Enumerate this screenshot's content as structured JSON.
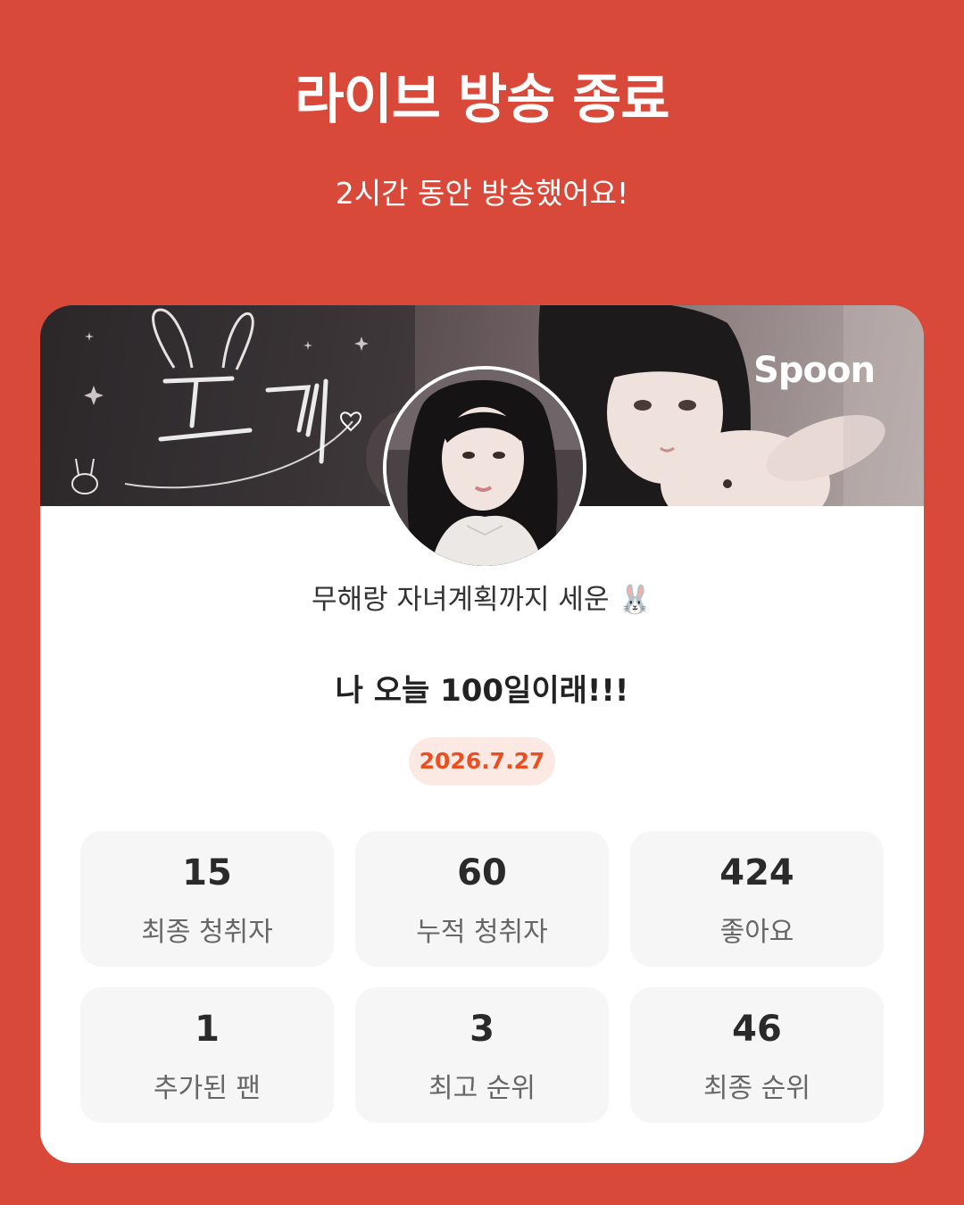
{
  "header": {
    "title": "라이브 방송 종료",
    "subtitle": "2시간 동안 방송했어요!"
  },
  "banner": {
    "logo_text": "Spoon",
    "handwriting_text": "토끼"
  },
  "profile": {
    "nickname": "무해랑 자녀계획까지 세운 🐰"
  },
  "live": {
    "title": "나 오늘 100일이래!!!",
    "date": "2026.7.27"
  },
  "stats": [
    {
      "value": "15",
      "label": "최종 청취자"
    },
    {
      "value": "60",
      "label": "누적 청취자"
    },
    {
      "value": "424",
      "label": "좋아요"
    },
    {
      "value": "1",
      "label": "추가된 팬"
    },
    {
      "value": "3",
      "label": "최고 순위"
    },
    {
      "value": "46",
      "label": "최종 순위"
    }
  ],
  "colors": {
    "background": "#d9493a",
    "card": "#ffffff",
    "date_text": "#ea4f22",
    "date_badge": "#fde9e4",
    "stat_box": "#f6f6f6"
  }
}
